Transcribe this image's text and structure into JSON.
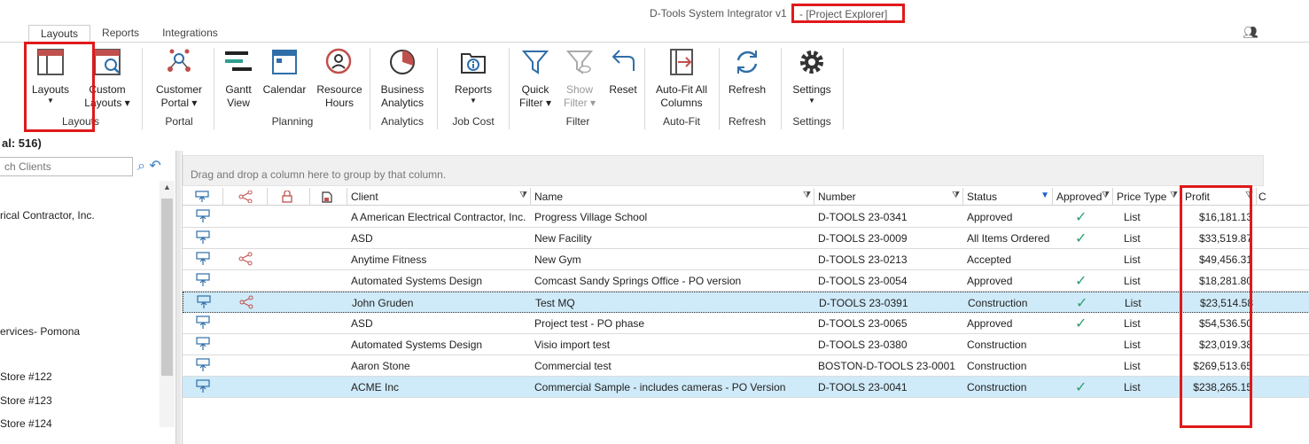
{
  "window": {
    "title": "D-Tools System Integrator v1",
    "subtitle": "- [Project Explorer]"
  },
  "tabs": [
    {
      "label": "Layouts",
      "active": true
    },
    {
      "label": "Reports"
    },
    {
      "label": "Integrations"
    }
  ],
  "ribbon": {
    "layouts": {
      "line1": "Layouts",
      "line2": ""
    },
    "custom_layouts": {
      "line1": "Custom",
      "line2": "Layouts ▾"
    },
    "customer_portal": {
      "line1": "Customer",
      "line2": "Portal ▾"
    },
    "gantt": {
      "line1": "Gantt",
      "line2": "View"
    },
    "calendar": {
      "line1": "Calendar",
      "line2": ""
    },
    "resource_hours": {
      "line1": "Resource",
      "line2": "Hours"
    },
    "business_analytics": {
      "line1": "Business",
      "line2": "Analytics"
    },
    "reports": {
      "line1": "Reports",
      "line2": ""
    },
    "quick_filter": {
      "line1": "Quick",
      "line2": "Filter ▾"
    },
    "show_filter": {
      "line1": "Show",
      "line2": "Filter ▾"
    },
    "reset": {
      "line1": "Reset",
      "line2": ""
    },
    "autofit": {
      "line1": "Auto-Fit All",
      "line2": "Columns"
    },
    "refresh": {
      "line1": "Refresh",
      "line2": ""
    },
    "settings": {
      "line1": "Settings",
      "line2": ""
    },
    "groups": {
      "layouts": "Layouts",
      "portal": "Portal",
      "planning": "Planning",
      "analytics": "Analytics",
      "job_cost": "Job Cost",
      "filter": "Filter",
      "autofit": "Auto-Fit",
      "refresh": "Refresh",
      "settings": "Settings"
    }
  },
  "left_panel": {
    "total": "al: 516)",
    "search_placeholder": "ch Clients",
    "items": [
      "rical Contractor, Inc.",
      "ervices- Pomona",
      "Store #122",
      "Store #123",
      "Store #124"
    ]
  },
  "grid": {
    "group_hint": "Drag and drop a column here to group by that column.",
    "columns": {
      "client": "Client",
      "name": "Name",
      "number": "Number",
      "status": "Status",
      "approved": "Approved",
      "price_type": "Price Type",
      "profit": "Profit",
      "cut": "C"
    },
    "rows": [
      {
        "client": "A American Electrical Contractor, Inc.",
        "name": "Progress Village School",
        "number": "D-TOOLS 23-0341",
        "status": "Approved",
        "approved": true,
        "price_type": "List",
        "profit": "$16,181.13",
        "shared": false,
        "selected": false
      },
      {
        "client": "ASD",
        "name": "New Facility",
        "number": "D-TOOLS 23-0009",
        "status": "All Items Ordered",
        "approved": true,
        "price_type": "List",
        "profit": "$33,519.87",
        "shared": false,
        "selected": false
      },
      {
        "client": "Anytime Fitness",
        "name": "New Gym",
        "number": "D-TOOLS 23-0213",
        "status": "Accepted",
        "approved": false,
        "price_type": "List",
        "profit": "$49,456.31",
        "shared": true,
        "selected": false
      },
      {
        "client": "Automated Systems Design",
        "name": "Comcast Sandy Springs Office - PO version",
        "number": "D-TOOLS 23-0054",
        "status": "Approved",
        "approved": true,
        "price_type": "List",
        "profit": "$18,281.80",
        "shared": false,
        "selected": false
      },
      {
        "client": "John Gruden",
        "name": "Test MQ",
        "number": "D-TOOLS 23-0391",
        "status": "Construction",
        "approved": true,
        "price_type": "List",
        "profit": "$23,514.58",
        "shared": true,
        "selected": true
      },
      {
        "client": "ASD",
        "name": "Project test - PO phase",
        "number": "D-TOOLS 23-0065",
        "status": "Approved",
        "approved": true,
        "price_type": "List",
        "profit": "$54,536.50",
        "shared": false,
        "selected": false
      },
      {
        "client": "Automated Systems Design",
        "name": "Visio import test",
        "number": "D-TOOLS 23-0380",
        "status": "Construction",
        "approved": false,
        "price_type": "List",
        "profit": "$23,019.38",
        "shared": false,
        "selected": false
      },
      {
        "client": "Aaron Stone",
        "name": "Commercial test",
        "number": "BOSTON-D-TOOLS 23-0001",
        "status": "Construction",
        "approved": false,
        "price_type": "List",
        "profit": "$269,513.65",
        "shared": false,
        "selected": false
      },
      {
        "client": "ACME Inc",
        "name": "Commercial Sample - includes cameras - PO Version",
        "number": "D-TOOLS 23-0041",
        "status": "Construction",
        "approved": true,
        "price_type": "List",
        "profit": "$238,265.15",
        "shared": false,
        "selected": true
      }
    ]
  },
  "colors": {
    "selected_row": "#cfeaf8",
    "highlight_box": "#e0191b",
    "check": "#2f9e6d",
    "accent": "#1b5fcc"
  }
}
